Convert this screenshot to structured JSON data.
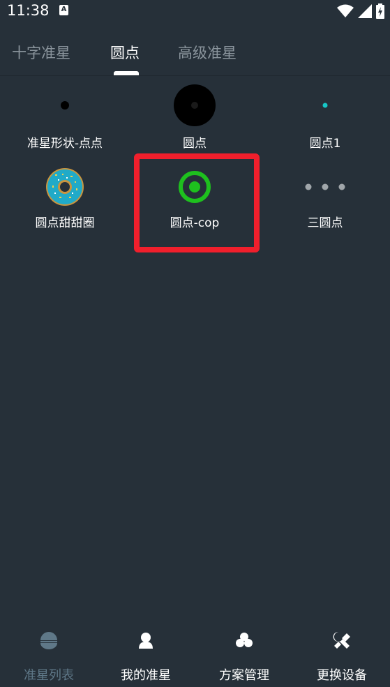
{
  "status": {
    "time": "11:38",
    "notif_glyph": "A"
  },
  "tabs": [
    {
      "label": "十字准星",
      "active": false
    },
    {
      "label": "圆点",
      "active": true
    },
    {
      "label": "高级准星",
      "active": false
    }
  ],
  "items": [
    {
      "label": "准星形状-点点",
      "icon": "small-dot-icon"
    },
    {
      "label": "圆点",
      "icon": "large-black-circle-icon"
    },
    {
      "label": "圆点1",
      "icon": "cyan-dot-icon"
    },
    {
      "label": "圆点甜甜圈",
      "icon": "donut-icon"
    },
    {
      "label": "圆点-cop",
      "icon": "green-ring-dot-icon",
      "highlighted": true
    },
    {
      "label": "三圆点",
      "icon": "three-dots-icon"
    }
  ],
  "nav": [
    {
      "label": "准星列表",
      "icon": "crosshair-list-icon",
      "active": true
    },
    {
      "label": "我的准星",
      "icon": "user-icon",
      "active": false
    },
    {
      "label": "方案管理",
      "icon": "cluster-icon",
      "active": false
    },
    {
      "label": "更换设备",
      "icon": "tools-icon",
      "active": false
    }
  ],
  "colors": {
    "background": "#263039",
    "highlight": "#f01f2c",
    "active_nav": "#5f7888",
    "green": "#1ec01e",
    "cyan": "#16c6c6"
  }
}
